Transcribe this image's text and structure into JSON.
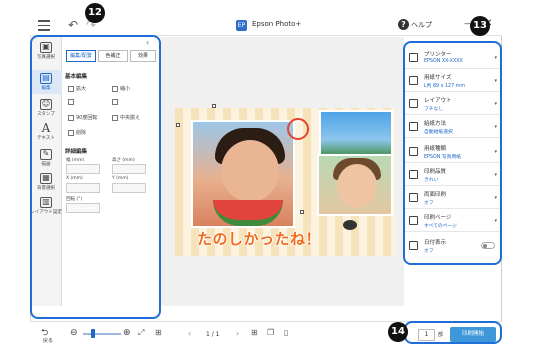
{
  "app": {
    "title": "Epson Photo+",
    "help": "ヘルプ",
    "icon_text": "EP"
  },
  "icon_column": {
    "items": [
      {
        "label": "写真選択"
      },
      {
        "label": "編集",
        "active": true
      },
      {
        "label": "スタンプ"
      },
      {
        "label": "テキスト"
      },
      {
        "label": "描画"
      },
      {
        "label": "背景選択"
      },
      {
        "label": "レイアウト設定"
      }
    ]
  },
  "edit_panel": {
    "tabs": [
      "編集/配置",
      "色補正",
      "効果"
    ],
    "basic_section": "基本編集",
    "tools": [
      "拡大",
      "縮小",
      "90度回転",
      "中央揃え",
      "削除"
    ],
    "detail_section": "詳細編集",
    "fields": {
      "width": "幅 (mm)",
      "height": "高さ (mm)",
      "x": "X (mm)",
      "y": "Y (mm)",
      "rotate": "回転 (°)"
    }
  },
  "canvas": {
    "caption": "たのしかったね！"
  },
  "settings": {
    "items": [
      {
        "label": "プリンター",
        "value": "EPSON XX-XXXX",
        "icon": "printer-icon"
      },
      {
        "label": "用紙サイズ",
        "value": "L判 89 x 127 mm",
        "icon": "paper-size-icon"
      },
      {
        "label": "レイアウト",
        "value": "フチなし",
        "icon": "layout-icon"
      },
      {
        "label": "給紙方法",
        "value": "自動給紙選択",
        "icon": "paper-feed-icon"
      },
      {
        "label": "用紙種類",
        "value": "EPSON 写真用紙",
        "icon": "paper-type-icon"
      },
      {
        "label": "印刷品質",
        "value": "きれい",
        "icon": "quality-icon"
      },
      {
        "label": "両面印刷",
        "value": "オフ",
        "icon": "duplex-icon"
      },
      {
        "label": "印刷ページ",
        "value": "すべてのページ",
        "icon": "pages-icon"
      },
      {
        "label": "日付表示",
        "value": "オフ",
        "icon": "date-icon",
        "toggle": false
      }
    ]
  },
  "bottom": {
    "back": "戻る",
    "page_indicator": "1 / 1",
    "copies": "1",
    "copies_unit": "部",
    "print_button": "印刷開始"
  },
  "callouts": [
    "12",
    "13",
    "14"
  ],
  "colors": {
    "accent": "#1f67c9",
    "callout": "#1f6fd6",
    "print_button": "#3d97d8"
  }
}
